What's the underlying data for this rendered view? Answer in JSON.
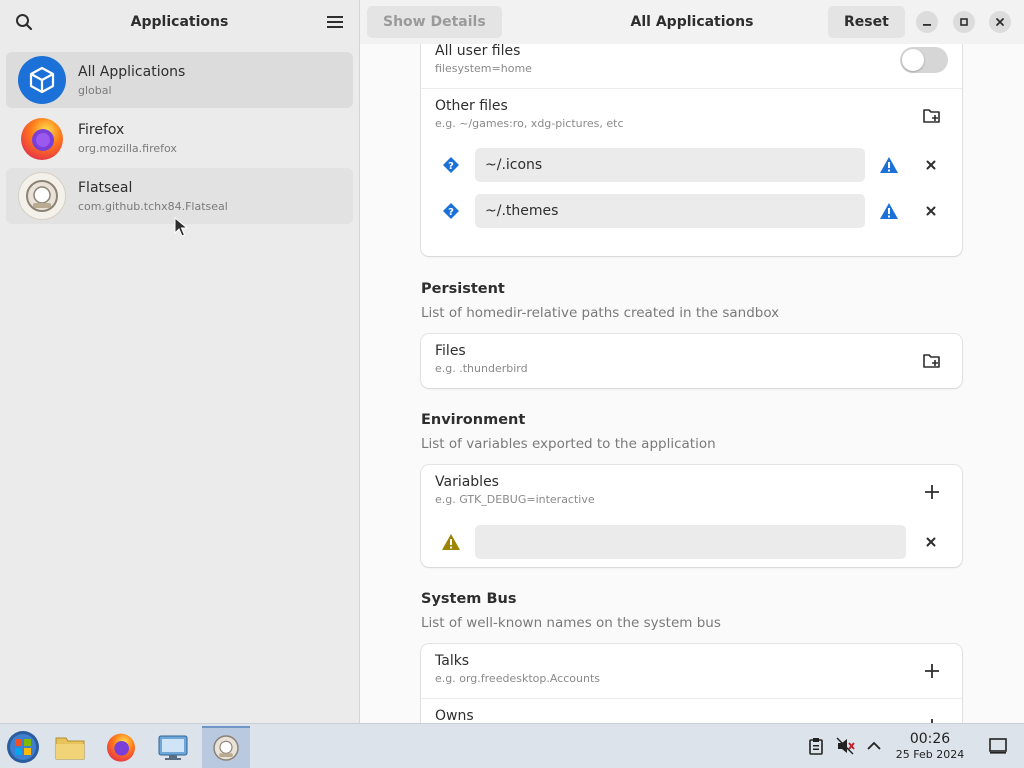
{
  "sidebar": {
    "title": "Applications",
    "apps": [
      {
        "name": "All Applications",
        "id": "global"
      },
      {
        "name": "Firefox",
        "id": "org.mozilla.firefox"
      },
      {
        "name": "Flatseal",
        "id": "com.github.tchx84.Flatseal"
      }
    ]
  },
  "header": {
    "show_details": "Show Details",
    "title": "All Applications",
    "reset": "Reset"
  },
  "filesystem": {
    "all_user_files": {
      "title": "All user files",
      "subtitle": "filesystem=home",
      "enabled": false
    },
    "other_files": {
      "title": "Other files",
      "subtitle": "e.g. ~/games:ro, xdg-pictures, etc"
    },
    "entries": [
      "~/.icons",
      "~/.themes"
    ]
  },
  "persistent": {
    "title": "Persistent",
    "description": "List of homedir-relative paths created in the sandbox",
    "files": {
      "title": "Files",
      "subtitle": "e.g. .thunderbird"
    }
  },
  "environment": {
    "title": "Environment",
    "description": "List of variables exported to the application",
    "variables": {
      "title": "Variables",
      "subtitle": "e.g. GTK_DEBUG=interactive"
    },
    "entry_value": ""
  },
  "system_bus": {
    "title": "System Bus",
    "description": "List of well-known names on the system bus",
    "talks": {
      "title": "Talks",
      "subtitle": "e.g. org.freedesktop.Accounts"
    },
    "owns": {
      "title": "Owns"
    }
  },
  "taskbar": {
    "time": "00:26",
    "date": "25 Feb 2024"
  },
  "colors": {
    "accent_blue": "#1c71d8",
    "warning_yellow": "#9c8300"
  }
}
